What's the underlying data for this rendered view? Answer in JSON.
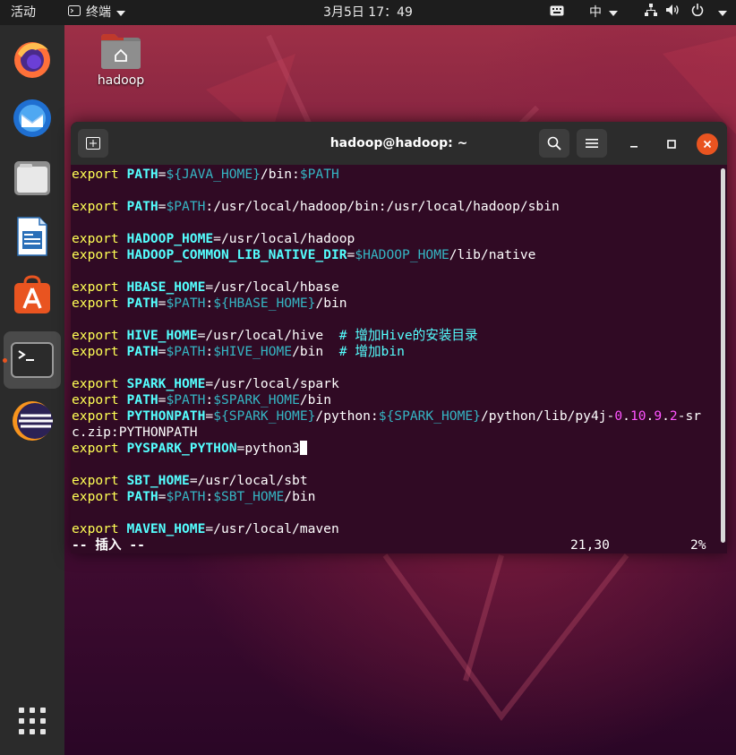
{
  "topbar": {
    "activities": "活动",
    "app_name": "终端",
    "clock": "3月5日  17：49",
    "input_method": "中"
  },
  "desktop": {
    "home_folder_label": "hadoop"
  },
  "dock": {
    "items": [
      "firefox",
      "thunderbird",
      "files",
      "libreoffice-writer",
      "ubuntu-software",
      "terminal",
      "eclipse",
      "show-applications"
    ]
  },
  "terminal": {
    "title": "hadoop@hadoop: ~",
    "mode": "-- 插入 --",
    "position": "21,30",
    "percent": "2%"
  },
  "lines": [
    [
      "export ",
      "PATH",
      "=",
      "${JAVA_HOME}",
      "/bin:",
      "$PATH",
      ""
    ],
    [],
    [
      "export ",
      "PATH",
      "=",
      "$PATH",
      ":/usr/local/hadoop/bin:/usr/local/hadoop/sbin",
      "",
      ""
    ],
    [],
    [
      "export ",
      "HADOOP_HOME",
      "=/usr/local/hadoop",
      "",
      "",
      "",
      ""
    ],
    [
      "export ",
      "HADOOP_COMMON_LIB_NATIVE_DIR",
      "=",
      "$HADOOP_HOME",
      "/lib/native",
      "",
      ""
    ],
    [],
    [
      "export ",
      "HBASE_HOME",
      "=/usr/local/hbase",
      "",
      "",
      "",
      ""
    ],
    [
      "export ",
      "PATH",
      "=",
      "$PATH",
      ":",
      "${HBASE_HOME}",
      "/bin"
    ],
    [],
    [
      "export ",
      "HIVE_HOME",
      "=/usr/local/hive  ",
      "# 增加Hive的安装目录",
      "",
      "",
      ""
    ],
    [
      "export ",
      "PATH",
      "=",
      "$PATH",
      ":",
      "$HIVE_HOME",
      "/bin  # 增加bin"
    ],
    [],
    [
      "export ",
      "SPARK_HOME",
      "=/usr/local/spark",
      "",
      "",
      "",
      ""
    ],
    [
      "export ",
      "PATH",
      "=",
      "$PATH",
      ":",
      "$SPARK_HOME",
      "/bin"
    ],
    [
      "export ",
      "PYTHONPATH",
      "=",
      "${SPARK_HOME}",
      "/python:",
      "${SPARK_HOME}",
      "/python/lib/py4j-0.10.9.2-sr"
    ],
    [
      "c.zip:PYTHONPATH",
      "",
      "",
      "",
      "",
      "",
      ""
    ],
    [
      "export ",
      "PYSPARK_PYTHON",
      "=python3",
      "",
      "",
      "",
      ""
    ],
    [],
    [
      "export ",
      "SBT_HOME",
      "=/usr/local/sbt",
      "",
      "",
      "",
      ""
    ],
    [
      "export ",
      "PATH",
      "=",
      "$PATH",
      ":",
      "$SBT_HOME",
      "/bin"
    ],
    [],
    [
      "export ",
      "MAVEN_HOME",
      "=/usr/local/maven",
      "",
      "",
      "",
      ""
    ]
  ]
}
